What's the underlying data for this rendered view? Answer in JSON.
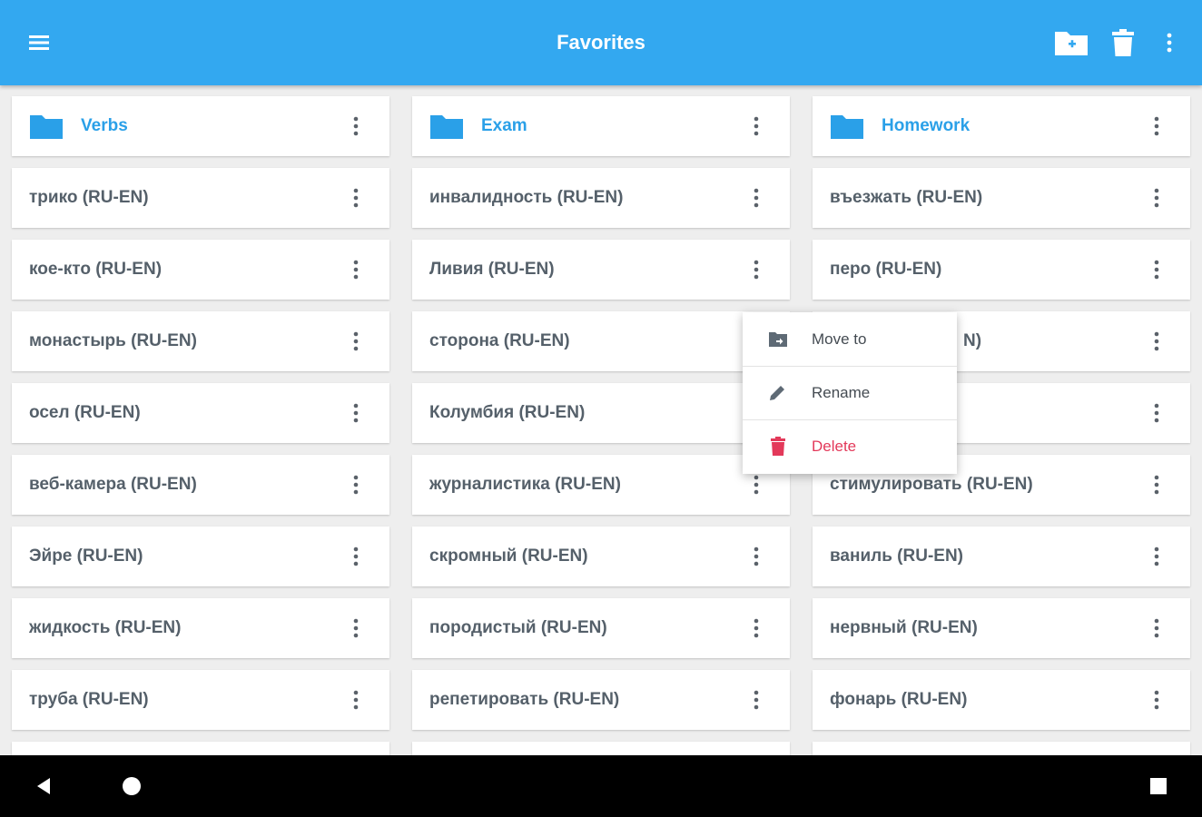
{
  "appbar": {
    "title": "Favorites",
    "color": "#33a8f0",
    "icons": [
      "menu-icon",
      "new-folder-icon",
      "trash-icon",
      "more-vertical-icon"
    ]
  },
  "columns": [
    {
      "folder": "Verbs",
      "items": [
        "трико (RU-EN)",
        "кое-кто (RU-EN)",
        "монастырь (RU-EN)",
        "осел (RU-EN)",
        "веб-камера (RU-EN)",
        "Эйре (RU-EN)",
        "жидкость (RU-EN)",
        "труба (RU-EN)"
      ]
    },
    {
      "folder": "Exam",
      "items": [
        "инвалидность (RU-EN)",
        "Ливия (RU-EN)",
        "сторона (RU-EN)",
        "Колумбия (RU-EN)",
        "журналистика (RU-EN)",
        "скромный (RU-EN)",
        "породистый (RU-EN)",
        "репетировать (RU-EN)"
      ]
    },
    {
      "folder": "Homework",
      "items": [
        "въезжать (RU-EN)",
        "перо (RU-EN)",
        "N)",
        "",
        "стимулировать (RU-EN)",
        "ваниль (RU-EN)",
        "нервный (RU-EN)",
        "фонарь (RU-EN)"
      ]
    }
  ],
  "context_menu": {
    "items": [
      {
        "label": "Move to",
        "icon": "move-to-folder-icon"
      },
      {
        "label": "Rename",
        "icon": "pencil-icon"
      },
      {
        "label": "Delete",
        "icon": "trash-icon"
      }
    ],
    "delete_color": "#e3395a"
  },
  "navbar": {
    "icons": [
      "back-icon",
      "home-icon",
      "recents-icon"
    ]
  },
  "colors": {
    "folder": "#2aa0e8",
    "text": "#55606a",
    "background": "#eeeeee"
  }
}
